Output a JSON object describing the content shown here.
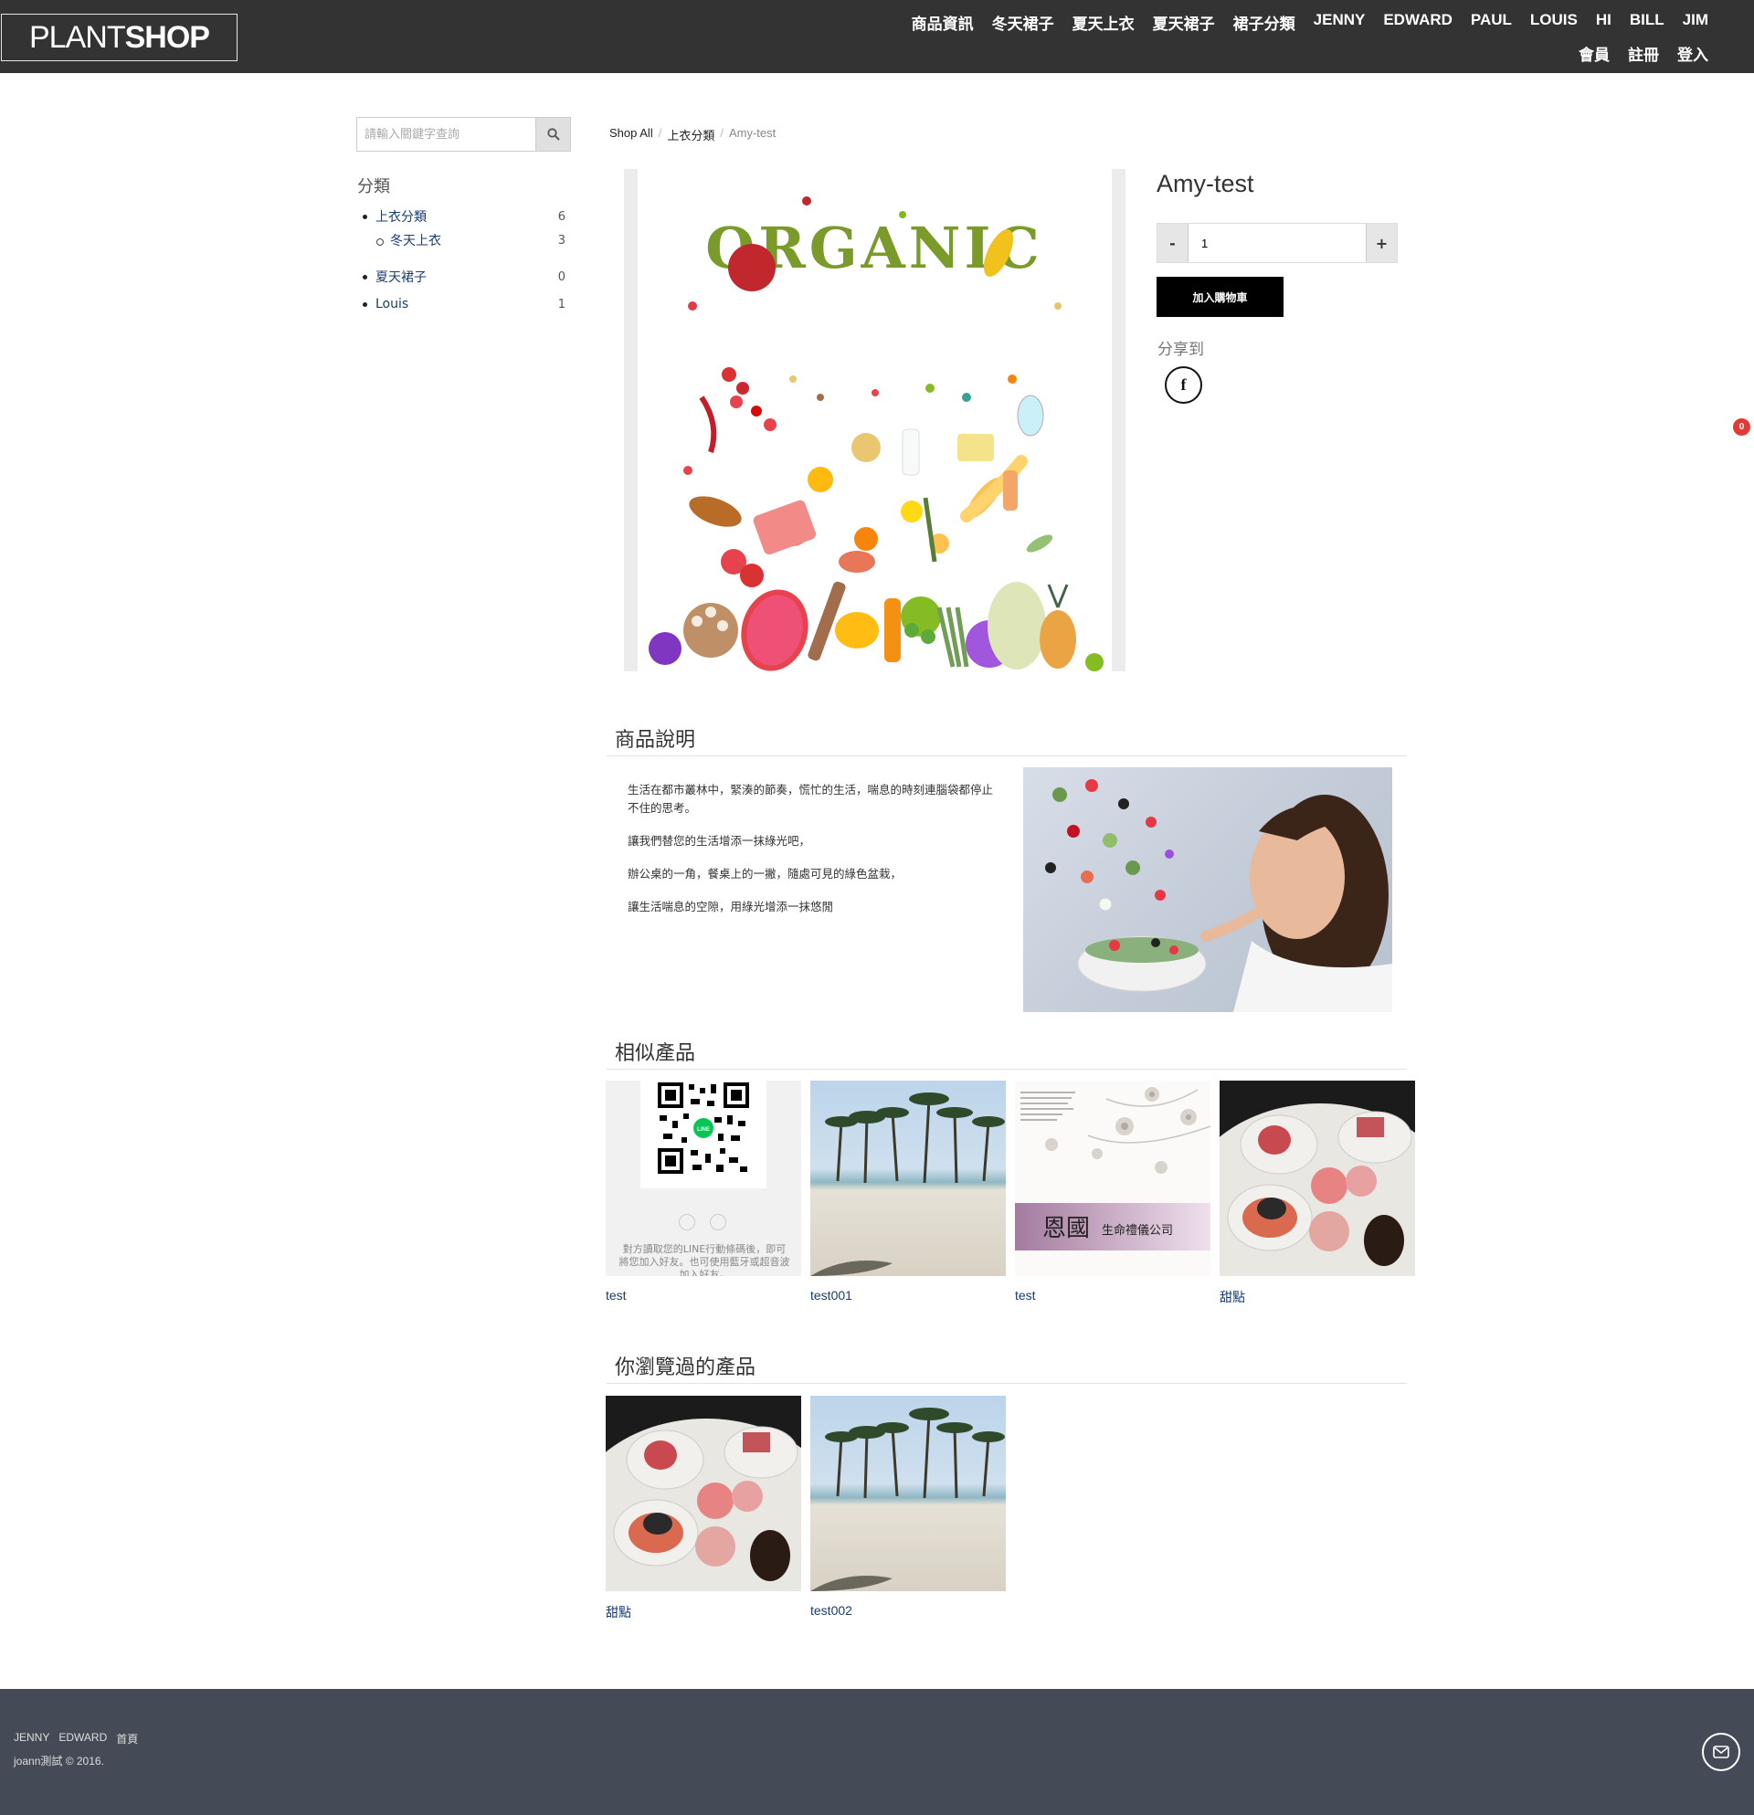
{
  "header": {
    "logo_light": "PLANT",
    "logo_bold": "SHOP",
    "nav_row1": [
      "商品資訊",
      "冬天裙子",
      "夏天上衣",
      "夏天裙子",
      "裙子分類",
      "JENNY",
      "EDWARD",
      "PAUL",
      "LOUIS",
      "HI",
      "BILL",
      "JIM"
    ],
    "nav_row2": [
      "會員",
      "註冊",
      "登入"
    ]
  },
  "sidebar": {
    "search_placeholder": "請輸入關鍵字查詢",
    "categories_title": "分類",
    "categories": [
      {
        "label": "上衣分類",
        "count": "6"
      },
      {
        "label": "冬天上衣",
        "count": "3"
      },
      {
        "label": "夏天裙子",
        "count": "0"
      },
      {
        "label": "Louis",
        "count": "1"
      }
    ]
  },
  "breadcrumb": [
    "Shop All",
    "上衣分類",
    "Amy-test"
  ],
  "product": {
    "title": "Amy-test",
    "quantity": "1",
    "minus_label": "-",
    "plus_label": "+",
    "add_to_cart_label": "加入購物車",
    "share_label": "分享到",
    "image_text": "ORGANIC"
  },
  "cart": {
    "count": "0"
  },
  "description": {
    "heading": "商品說明",
    "paragraphs": [
      "生活在都市叢林中，緊湊的節奏，慌忙的生活，喘息的時刻連腦袋都停止不住的思考。",
      "讓我們替您的生活增添一抹綠光吧，",
      "辦公桌的一角，餐桌上的一撇，隨處可見的綠色盆栽，",
      "讓生活喘息的空隙，用綠光增添一抹悠閒"
    ]
  },
  "similar": {
    "heading": "相似產品",
    "items": [
      {
        "label": "test",
        "image": "line-qr-code"
      },
      {
        "label": "test001",
        "image": "palm-beach"
      },
      {
        "label": "test",
        "image": "floral-card"
      },
      {
        "label": "甜點",
        "image": "dessert-plate"
      }
    ],
    "qr_caption": "對方讀取您的LINE行動條碼後，即可將您加入好友。也可使用藍牙或超音波加入好友。",
    "qr_badge": "LINE",
    "card_brand": "恩國",
    "card_subtitle": "生命禮儀公司"
  },
  "viewed": {
    "heading": "你瀏覽過的產品",
    "items": [
      {
        "label": "甜點",
        "image": "dessert-plate"
      },
      {
        "label": "test002",
        "image": "palm-beach"
      }
    ]
  },
  "footer": {
    "links": [
      "JENNY",
      "EDWARD",
      "首頁"
    ],
    "copyright": "joann測試 © 2016."
  },
  "colors": {
    "header_bg": "#333333",
    "footer_bg": "#454b56",
    "link": "#1a3c6e",
    "badge": "#e53935"
  }
}
